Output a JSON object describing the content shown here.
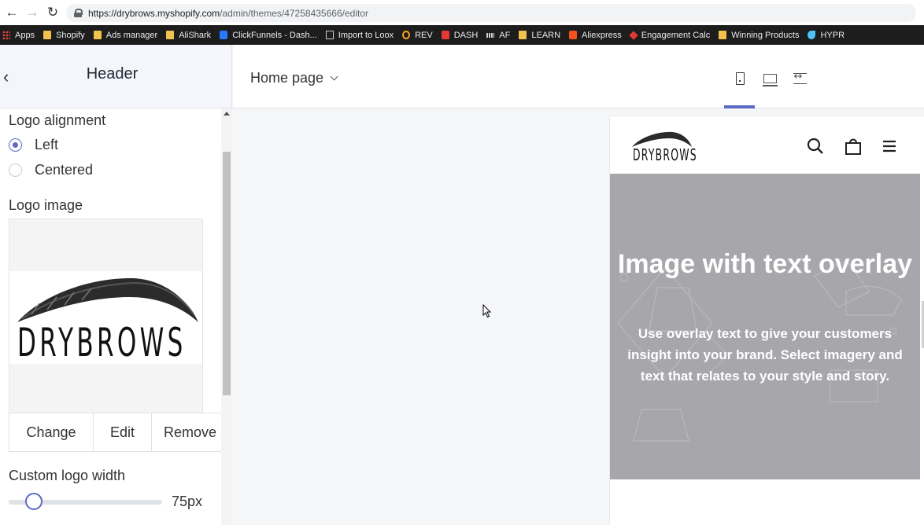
{
  "browser": {
    "url_host": "https://drybrows.myshopify.com",
    "url_path": "/admin/themes/47258435666/editor"
  },
  "bookmarks": [
    {
      "label": "Apps",
      "icon": "apps-grid-icon"
    },
    {
      "label": "Shopify",
      "icon": "folder-icon"
    },
    {
      "label": "Ads manager",
      "icon": "folder-icon"
    },
    {
      "label": "AliShark",
      "icon": "folder-icon"
    },
    {
      "label": "ClickFunnels - Dash...",
      "icon": "clickfunnels-icon"
    },
    {
      "label": "Import to Loox",
      "icon": "page-icon"
    },
    {
      "label": "REV",
      "icon": "ring-icon"
    },
    {
      "label": "DASH",
      "icon": "youtube-icon"
    },
    {
      "label": "AF",
      "icon": "bars-icon"
    },
    {
      "label": "LEARN",
      "icon": "folder-icon"
    },
    {
      "label": "Aliexpress",
      "icon": "aliexpress-icon"
    },
    {
      "label": "Engagement Calc",
      "icon": "diamond-icon"
    },
    {
      "label": "Winning Products",
      "icon": "folder-icon"
    },
    {
      "label": "HYPR",
      "icon": "bird-icon"
    }
  ],
  "sidebar": {
    "title": "Header",
    "logo_alignment_label": "Logo alignment",
    "alignment_options": [
      {
        "label": "Left",
        "selected": true
      },
      {
        "label": "Centered",
        "selected": false
      }
    ],
    "logo_image_label": "Logo image",
    "logo_text": "DRYBROWS",
    "buttons": {
      "change": "Change",
      "edit": "Edit",
      "remove": "Remove"
    },
    "custom_width_label": "Custom logo width",
    "custom_width_value": "75px",
    "custom_width_fraction": 0.17
  },
  "topbar": {
    "page_select": "Home page",
    "device_buttons": [
      "mobile-icon",
      "desktop-icon",
      "fullscreen-icon"
    ],
    "active_device": "mobile"
  },
  "preview": {
    "logo_text": "DRYBROWS",
    "hero_title": "Image with text overlay",
    "hero_text": "Use overlay text to give your customers insight into your brand. Select imagery and text that relates to your style and story."
  },
  "colors": {
    "accent": "#5c6ac4",
    "hero_bg": "#a7a7ab",
    "canvas_bg": "#f4f6f8"
  }
}
